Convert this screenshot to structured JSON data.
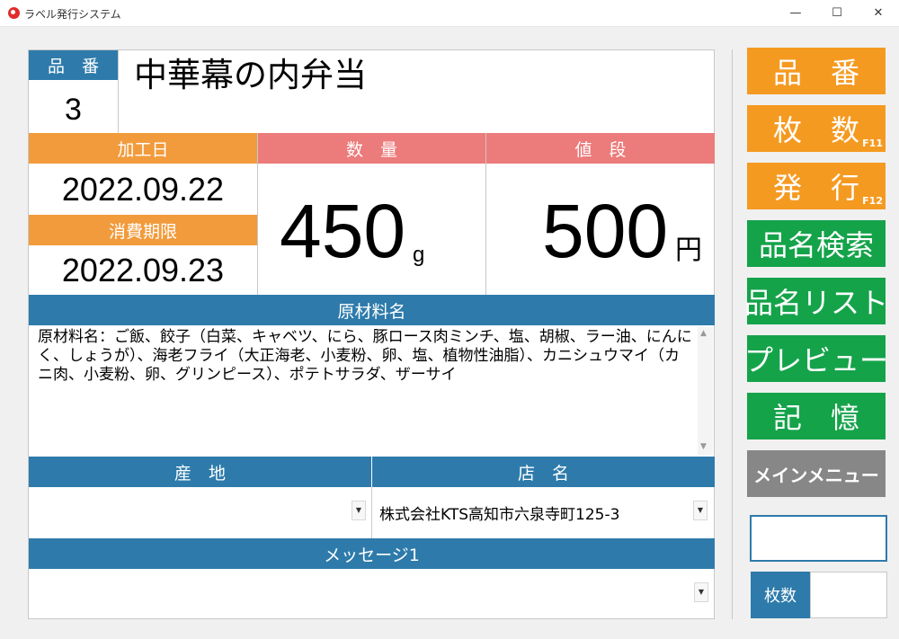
{
  "window": {
    "title": "ラベル発行システム",
    "minimize_icon": "minimize-icon",
    "maximize_icon": "maximize-icon",
    "close_icon": "close-icon"
  },
  "product": {
    "number_label": "品　番",
    "number_value": "3",
    "name": "中華幕の内弁当"
  },
  "processing_date": {
    "label": "加工日",
    "value": "2022.09.22"
  },
  "expiry_date": {
    "label": "消費期限",
    "value": "2022.09.23"
  },
  "quantity": {
    "label": "数　量",
    "value": "450",
    "unit": "g"
  },
  "price": {
    "label": "値　段",
    "value": "500",
    "unit": "円"
  },
  "ingredients": {
    "label": "原材料名",
    "text": "原材料名：ご飯、餃子（白菜、キャベツ、にら、豚ロース肉ミンチ、塩、胡椒、ラー油、にんにく、しょうが）、海老フライ（大正海老、小麦粉、卵、塩、植物性油脂）、カニシュウマイ（カニ肉、小麦粉、卵、グリンピース）、ポテトサラダ、ザーサイ"
  },
  "origin": {
    "label": "産　地",
    "value": ""
  },
  "store": {
    "label": "店　名",
    "value": "株式会社KTS高知市六泉寺町125-3"
  },
  "message": {
    "label": "メッセージ1",
    "value": ""
  },
  "sidebar": {
    "buttons": [
      {
        "label": "品　番",
        "key": ""
      },
      {
        "label": "枚　数",
        "key": "F11"
      },
      {
        "label": "発　行",
        "key": "F12"
      },
      {
        "label": "品名検索",
        "key": ""
      },
      {
        "label": "品名リスト",
        "key": ""
      },
      {
        "label": "プレビュー",
        "key": ""
      },
      {
        "label": "記　憶",
        "key": ""
      },
      {
        "label": "メインメニュー",
        "key": ""
      }
    ],
    "count_label": "枚数",
    "count_value": ""
  },
  "colors": {
    "header_blue": "#2e7bab",
    "header_orange": "#f29b3c",
    "header_pink": "#ec7b7b",
    "button_orange": "#f59a21",
    "button_green": "#15a34a",
    "button_gray": "#878787"
  }
}
